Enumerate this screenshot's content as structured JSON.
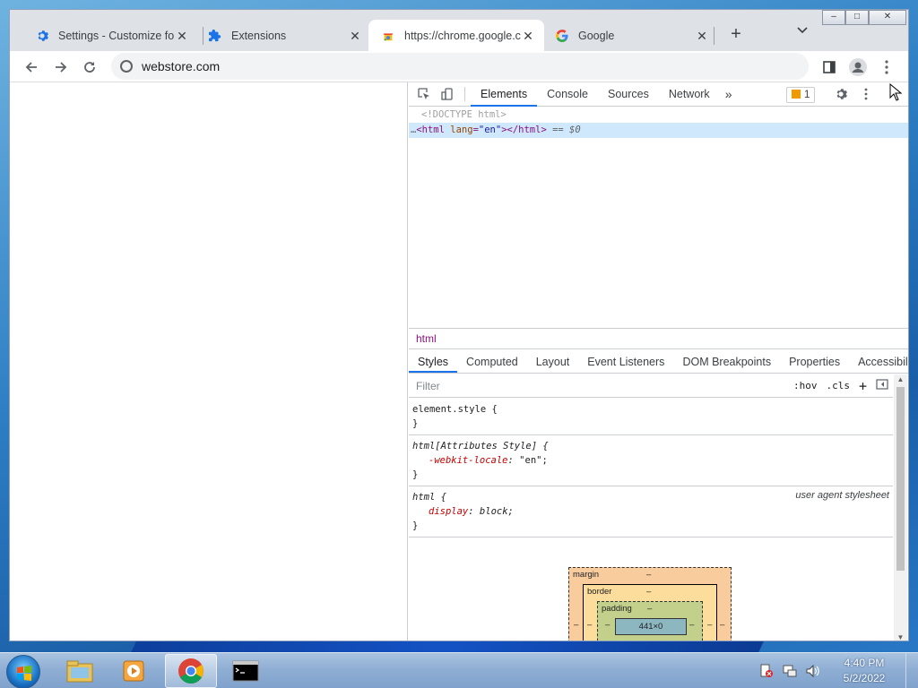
{
  "browser": {
    "tabs": [
      {
        "title": "Settings - Customize fo",
        "icon": "gear-icon",
        "active": false
      },
      {
        "title": "Extensions",
        "icon": "puzzle-icon",
        "active": false
      },
      {
        "title": "https://chrome.google.c",
        "icon": "chrome-webstore-icon",
        "active": true
      },
      {
        "title": "Google",
        "icon": "google-icon",
        "active": false
      }
    ],
    "tab_close_glyph": "✕",
    "new_tab_glyph": "+",
    "tab_search_glyph": "⌄",
    "window_controls": {
      "minimize": "–",
      "maximize": "□",
      "close": "✕"
    },
    "address": "webstore.com"
  },
  "devtools": {
    "tabs": [
      "Elements",
      "Console",
      "Sources",
      "Network"
    ],
    "active_tab": "Elements",
    "more_tabs_glyph": "»",
    "issues_count": "1",
    "dom": {
      "doctype": "<!DOCTYPE html>",
      "html_open_tag": "<html",
      "html_attr_name": "lang",
      "html_attr_value": "\"en\"",
      "html_close": "></html>",
      "selected_marker": "== $0",
      "ellipsis": "…"
    },
    "breadcrumb": "html",
    "subtabs": [
      "Styles",
      "Computed",
      "Layout",
      "Event Listeners",
      "DOM Breakpoints",
      "Properties",
      "Accessibility"
    ],
    "active_subtab": "Styles",
    "filter_placeholder": "Filter",
    "filter_hov": ":hov",
    "filter_cls": ".cls",
    "filter_plus": "+",
    "rules": [
      {
        "selector": "element.style {",
        "props": [],
        "close": "}",
        "origin": ""
      },
      {
        "selector": "html[Attributes Style] {",
        "props": [
          {
            "name": "-webkit-locale",
            "value": "\"en\";"
          }
        ],
        "close": "}",
        "origin": ""
      },
      {
        "selector": "html {",
        "props": [
          {
            "name": "display",
            "value": "block;"
          }
        ],
        "close": "}",
        "origin": "user agent stylesheet"
      }
    ],
    "box_model": {
      "margin_label": "margin",
      "border_label": "border",
      "padding_label": "padding",
      "content_size": "441×0",
      "empty": "–"
    }
  },
  "taskbar": {
    "apps": [
      "file-explorer-icon",
      "media-player-icon",
      "chrome-icon",
      "command-prompt-icon"
    ],
    "active_app": "chrome-icon",
    "time": "4:40 PM",
    "date": "5/2/2022"
  }
}
